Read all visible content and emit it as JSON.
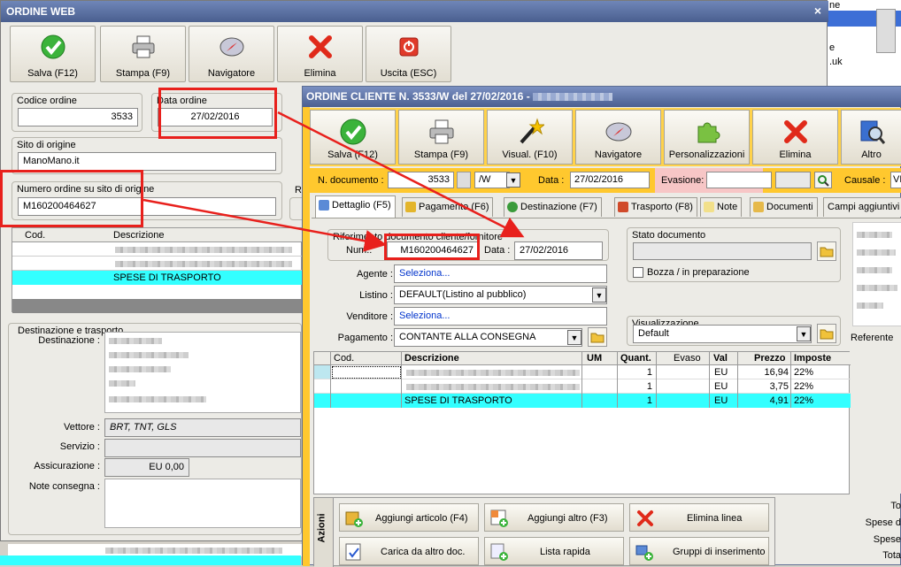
{
  "back": {
    "title": "ORDINE WEB",
    "close": "×",
    "toolbar": [
      "Salva (F12)",
      "Stampa (F9)",
      "Navigatore",
      "Elimina",
      "Uscita (ESC)"
    ],
    "codice_ordine_label": "Codice ordine",
    "codice_ordine_value": "3533",
    "data_ordine_label": "Data ordine",
    "data_ordine_value": "27/02/2016",
    "sito_label": "Sito di origine",
    "sito_value": "ManoMano.it",
    "numero_label": "Numero ordine su sito di origine",
    "numero_value": "M160200464627",
    "r_label": "R",
    "grid_cod": "Cod.",
    "grid_desc": "Descrizione",
    "grid_row3": "SPESE DI TRASPORTO",
    "dest_group": "Destinazione e trasporto",
    "destinazione": "Destinazione :",
    "vettore": "Vettore :",
    "vettore_value": "BRT, TNT, GLS",
    "servizio": "Servizio :",
    "assicurazione": "Assicurazione :",
    "assicurazione_value": "EU 0,00",
    "note": "Note consegna :"
  },
  "edge": {
    "text1": "ne",
    "text2": "e",
    "text3": ".uk",
    "bottom": [
      "To",
      "Spese d",
      "Spese",
      "Tota"
    ]
  },
  "front": {
    "title": "ORDINE CLIENTE N. 3533/W del 27/02/2016 - ",
    "toolbar": [
      "Salva (F12)",
      "Stampa (F9)",
      "Visual. (F10)",
      "Navigatore",
      "Personalizzazioni",
      "Elimina",
      "Altro"
    ],
    "ndoc_label": "N. documento :",
    "ndoc_value": "3533",
    "ndoc_suffix": "/W",
    "data_label": "Data :",
    "data_value": "27/02/2016",
    "evasione_label": "Evasione:",
    "causale_label": "Causale :",
    "causale_value": "VE",
    "tabs": [
      "Dettaglio (F5)",
      "Pagamento (F6)",
      "Destinazione (F7)",
      "Trasporto (F8)",
      "Note",
      "Documenti",
      "Campi aggiuntivi"
    ],
    "rif_group": "Riferimento documento cliente/fornitore",
    "num_label": "Num.:",
    "num_value": "M160200464627",
    "rif_data_label": "Data :",
    "rif_data_value": "27/02/2016",
    "stato_group": "Stato documento",
    "bozza_label": "Bozza / in preparazione",
    "agente_label": "Agente :",
    "agente_value": "Seleziona...",
    "listino_label": "Listino :",
    "listino_value": "DEFAULT(Listino al pubblico)",
    "venditore_label": "Venditore :",
    "venditore_value": "Seleziona...",
    "pagamento_label": "Pagamento :",
    "pagamento_value": "CONTANTE ALLA CONSEGNA",
    "visual_group": "Visualizzazione",
    "visual_value": "Default",
    "referente": "Referente",
    "grid_headers": [
      "Cod.",
      "Descrizione",
      "UM",
      "Quant.",
      "Evaso",
      "Val",
      "Prezzo",
      "Imposte"
    ],
    "rows": [
      {
        "desc": "",
        "um": "",
        "quant": "1",
        "evaso": "",
        "val": "EU",
        "prezzo": "16,94",
        "imposte": "22%"
      },
      {
        "desc": "",
        "um": "",
        "quant": "1",
        "evaso": "",
        "val": "EU",
        "prezzo": "3,75",
        "imposte": "22%"
      },
      {
        "desc": "SPESE DI TRASPORTO",
        "um": "",
        "quant": "1",
        "evaso": "",
        "val": "EU",
        "prezzo": "4,91",
        "imposte": "22%"
      }
    ],
    "azioni": "Azioni",
    "actions": [
      "Aggiungi articolo (F4)",
      "Aggiungi altro (F3)",
      "Elimina linea",
      "Carica da altro doc.",
      "Lista rapida",
      "Gruppi di inserimento"
    ]
  },
  "colors": {
    "accent": "#ffc82e",
    "highlight": "#33ffff",
    "annotation": "#e8201c"
  }
}
